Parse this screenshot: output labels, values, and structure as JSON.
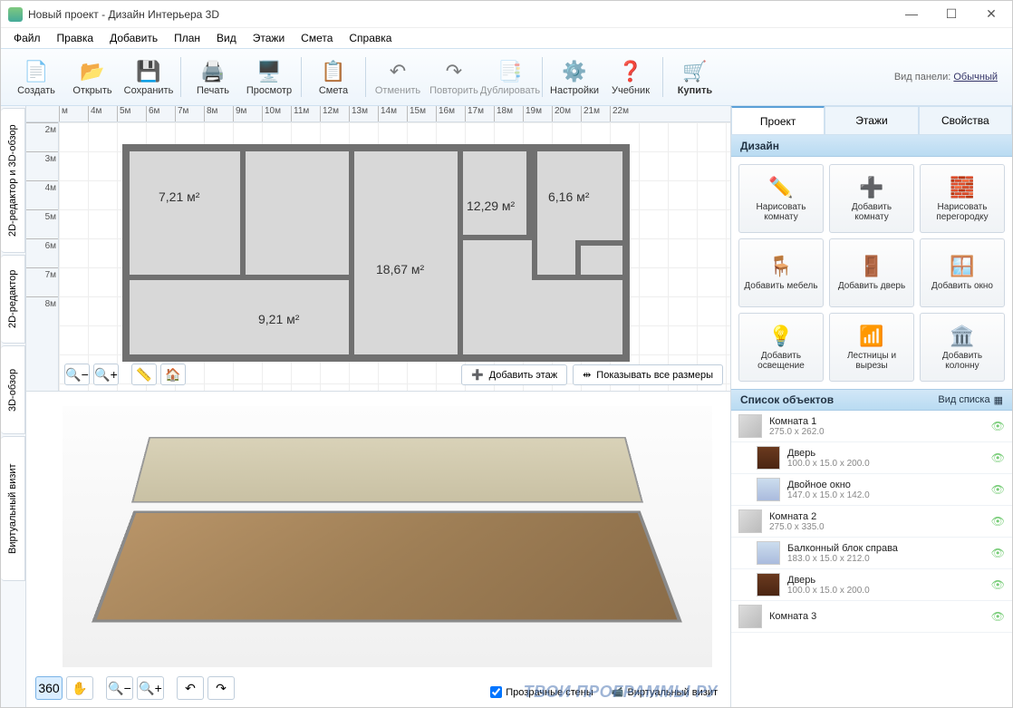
{
  "window": {
    "title": "Новый проект - Дизайн Интерьера 3D"
  },
  "menu": [
    "Файл",
    "Правка",
    "Добавить",
    "План",
    "Вид",
    "Этажи",
    "Смета",
    "Справка"
  ],
  "toolbar": {
    "create": "Создать",
    "open": "Открыть",
    "save": "Сохранить",
    "print": "Печать",
    "preview": "Просмотр",
    "estimate": "Смета",
    "undo": "Отменить",
    "redo": "Повторить",
    "duplicate": "Дублировать",
    "settings": "Настройки",
    "tutorial": "Учебник",
    "buy": "Купить",
    "panel_label": "Вид панели:",
    "panel_mode": "Обычный"
  },
  "sidetabs": {
    "combo": "2D-редактор и 3D-обзор",
    "editor2d": "2D-редактор",
    "view3d": "3D-обзор",
    "virtual": "Виртуальный визит"
  },
  "ruler_h": [
    "м",
    "4м",
    "5м",
    "6м",
    "7м",
    "8м",
    "9м",
    "10м",
    "11м",
    "12м",
    "13м",
    "14м",
    "15м",
    "16м",
    "17м",
    "18м",
    "19м",
    "20м",
    "21м",
    "22м"
  ],
  "ruler_v": [
    "2м",
    "3м",
    "4м",
    "5м",
    "6м",
    "7м",
    "8м"
  ],
  "rooms": {
    "r1": "7,21 м²",
    "r2": "18,67 м²",
    "r3": "12,29 м²",
    "r4": "6,16 м²",
    "r5": "9,21 м²"
  },
  "plan_actions": {
    "add_floor": "Добавить этаж",
    "show_dims": "Показывать все размеры"
  },
  "view3d": {
    "transparent": "Прозрачные стены",
    "record": "Виртуальный визит"
  },
  "rtabs": {
    "project": "Проект",
    "floors": "Этажи",
    "props": "Свойства"
  },
  "design_head": "Дизайн",
  "design_buttons": [
    {
      "id": "draw-room",
      "label": "Нарисовать комнату",
      "icon": "✏️"
    },
    {
      "id": "add-room",
      "label": "Добавить комнату",
      "icon": "➕"
    },
    {
      "id": "draw-partition",
      "label": "Нарисовать перегородку",
      "icon": "🧱"
    },
    {
      "id": "add-furniture",
      "label": "Добавить мебель",
      "icon": "🪑"
    },
    {
      "id": "add-door",
      "label": "Добавить дверь",
      "icon": "🚪"
    },
    {
      "id": "add-window",
      "label": "Добавить окно",
      "icon": "🪟"
    },
    {
      "id": "add-light",
      "label": "Добавить освещение",
      "icon": "💡"
    },
    {
      "id": "stairs",
      "label": "Лестницы и вырезы",
      "icon": "📶"
    },
    {
      "id": "add-column",
      "label": "Добавить колонну",
      "icon": "🏛️"
    }
  ],
  "objlist_head": "Список объектов",
  "objlist_mode": "Вид списка",
  "objects": [
    {
      "name": "Комната 1",
      "dim": "275.0 x 262.0",
      "type": "room",
      "indent": false
    },
    {
      "name": "Дверь",
      "dim": "100.0 x 15.0 x 200.0",
      "type": "door",
      "indent": true
    },
    {
      "name": "Двойное окно",
      "dim": "147.0 x 15.0 x 142.0",
      "type": "win",
      "indent": true
    },
    {
      "name": "Комната 2",
      "dim": "275.0 x 335.0",
      "type": "room",
      "indent": false
    },
    {
      "name": "Балконный блок справа",
      "dim": "183.0 x 15.0 x 212.0",
      "type": "win",
      "indent": true
    },
    {
      "name": "Дверь",
      "dim": "100.0 x 15.0 x 200.0",
      "type": "door",
      "indent": true
    },
    {
      "name": "Комната 3",
      "dim": "",
      "type": "room",
      "indent": false
    }
  ],
  "watermark": "ТВОИ ПРОГРАММЫ РУ"
}
